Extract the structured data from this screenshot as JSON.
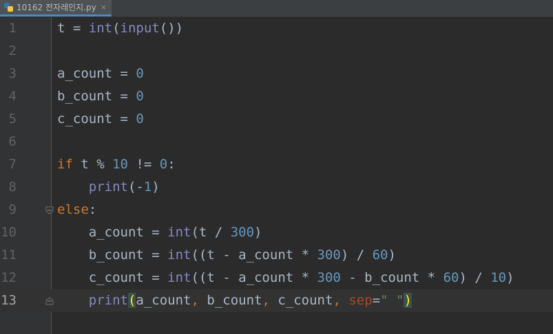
{
  "tab": {
    "filename": "10162 전자레인지.py",
    "close": "×"
  },
  "lines": [
    {
      "num": "1",
      "tokens": [
        [
          "",
          "t = "
        ],
        [
          "fn",
          "int"
        ],
        [
          "",
          "("
        ],
        [
          "fn",
          "input"
        ],
        [
          "",
          "())"
        ]
      ]
    },
    {
      "num": "2",
      "tokens": []
    },
    {
      "num": "3",
      "tokens": [
        [
          "",
          "a_count = "
        ],
        [
          "num",
          "0"
        ]
      ]
    },
    {
      "num": "4",
      "tokens": [
        [
          "",
          "b_count = "
        ],
        [
          "num",
          "0"
        ]
      ]
    },
    {
      "num": "5",
      "tokens": [
        [
          "",
          "c_count = "
        ],
        [
          "num",
          "0"
        ]
      ]
    },
    {
      "num": "6",
      "tokens": []
    },
    {
      "num": "7",
      "tokens": [
        [
          "kw",
          "if"
        ],
        [
          "",
          " t % "
        ],
        [
          "num",
          "10"
        ],
        [
          "",
          " != "
        ],
        [
          "num",
          "0"
        ],
        [
          "",
          ":"
        ]
      ]
    },
    {
      "num": "8",
      "tokens": [
        [
          "",
          "    "
        ],
        [
          "fn",
          "print"
        ],
        [
          "",
          "(-"
        ],
        [
          "num",
          "1"
        ],
        [
          "",
          ")"
        ]
      ]
    },
    {
      "num": "9",
      "tokens": [
        [
          "kw",
          "else"
        ],
        [
          "",
          ":"
        ]
      ]
    },
    {
      "num": "10",
      "tokens": [
        [
          "",
          "    a_count = "
        ],
        [
          "fn",
          "int"
        ],
        [
          "",
          "(t / "
        ],
        [
          "num",
          "300"
        ],
        [
          "",
          ")"
        ]
      ]
    },
    {
      "num": "11",
      "tokens": [
        [
          "",
          "    b_count = "
        ],
        [
          "fn",
          "int"
        ],
        [
          "",
          "((t - a_count * "
        ],
        [
          "num",
          "300"
        ],
        [
          "",
          ") / "
        ],
        [
          "num",
          "60"
        ],
        [
          "",
          ")"
        ]
      ]
    },
    {
      "num": "12",
      "tokens": [
        [
          "",
          "    c_count = "
        ],
        [
          "fn",
          "int"
        ],
        [
          "",
          "((t - a_count * "
        ],
        [
          "num",
          "300"
        ],
        [
          "",
          " - b_count * "
        ],
        [
          "num",
          "60"
        ],
        [
          "",
          ") / "
        ],
        [
          "num",
          "10"
        ],
        [
          "",
          ")"
        ]
      ]
    },
    {
      "num": "13",
      "tokens": [
        [
          "",
          "    "
        ],
        [
          "fn",
          "print"
        ],
        [
          "bm",
          "("
        ],
        [
          "",
          "a_count"
        ],
        [
          "punct",
          ","
        ],
        [
          "",
          " b_count"
        ],
        [
          "punct",
          ","
        ],
        [
          "",
          " c_count"
        ],
        [
          "punct",
          ","
        ],
        [
          "",
          " "
        ],
        [
          "param",
          "sep"
        ],
        [
          "",
          "="
        ],
        [
          "str",
          "\" \""
        ],
        [
          "bm",
          ")"
        ]
      ]
    }
  ],
  "current_line": "13",
  "colors": {
    "background": "#2b2b2b",
    "gutter": "#313335",
    "keyword": "#cc7832",
    "builtin": "#8888c6",
    "number": "#6897bb",
    "string": "#6a8759",
    "param": "#aa4926"
  }
}
